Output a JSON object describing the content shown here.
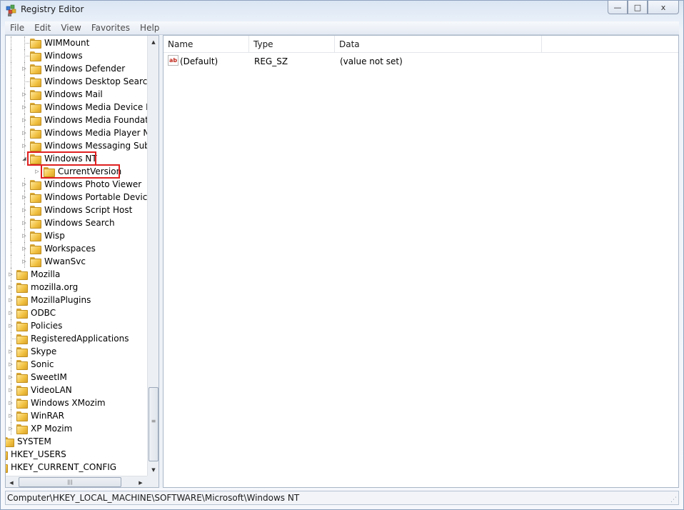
{
  "window": {
    "title": "Registry Editor",
    "caption_min": "—",
    "caption_max": "□",
    "caption_close": "x"
  },
  "menu": [
    "File",
    "Edit",
    "View",
    "Favorites",
    "Help"
  ],
  "tree": [
    {
      "label": "WIMMount",
      "level": 2,
      "expander": "none"
    },
    {
      "label": "Windows",
      "level": 2,
      "expander": "none"
    },
    {
      "label": "Windows Defender",
      "level": 2,
      "expander": "collapsed"
    },
    {
      "label": "Windows Desktop Search",
      "level": 2,
      "expander": "none"
    },
    {
      "label": "Windows Mail",
      "level": 2,
      "expander": "collapsed"
    },
    {
      "label": "Windows Media Device Ma",
      "level": 2,
      "expander": "collapsed"
    },
    {
      "label": "Windows Media Foundation",
      "level": 2,
      "expander": "collapsed"
    },
    {
      "label": "Windows Media Player NSS",
      "level": 2,
      "expander": "collapsed"
    },
    {
      "label": "Windows Messaging Subsy",
      "level": 2,
      "expander": "collapsed"
    },
    {
      "label": "Windows NT",
      "level": 2,
      "expander": "expanded",
      "highlighted": true
    },
    {
      "label": "CurrentVersion",
      "level": 3,
      "expander": "collapsed",
      "highlighted": true
    },
    {
      "label": "Windows Photo Viewer",
      "level": 2,
      "expander": "collapsed"
    },
    {
      "label": "Windows Portable Devices",
      "level": 2,
      "expander": "collapsed"
    },
    {
      "label": "Windows Script Host",
      "level": 2,
      "expander": "collapsed"
    },
    {
      "label": "Windows Search",
      "level": 2,
      "expander": "collapsed"
    },
    {
      "label": "Wisp",
      "level": 2,
      "expander": "collapsed"
    },
    {
      "label": "Workspaces",
      "level": 2,
      "expander": "collapsed"
    },
    {
      "label": "WwanSvc",
      "level": 2,
      "expander": "collapsed"
    },
    {
      "label": "Mozilla",
      "level": 1,
      "expander": "collapsed"
    },
    {
      "label": "mozilla.org",
      "level": 1,
      "expander": "collapsed"
    },
    {
      "label": "MozillaPlugins",
      "level": 1,
      "expander": "collapsed"
    },
    {
      "label": "ODBC",
      "level": 1,
      "expander": "collapsed"
    },
    {
      "label": "Policies",
      "level": 1,
      "expander": "collapsed"
    },
    {
      "label": "RegisteredApplications",
      "level": 1,
      "expander": "none"
    },
    {
      "label": "Skype",
      "level": 1,
      "expander": "collapsed"
    },
    {
      "label": "Sonic",
      "level": 1,
      "expander": "collapsed"
    },
    {
      "label": "SweetIM",
      "level": 1,
      "expander": "collapsed"
    },
    {
      "label": "VideoLAN",
      "level": 1,
      "expander": "collapsed"
    },
    {
      "label": "Windows XMozim",
      "level": 1,
      "expander": "collapsed"
    },
    {
      "label": "WinRAR",
      "level": 1,
      "expander": "collapsed"
    },
    {
      "label": "XP Mozim",
      "level": 1,
      "expander": "collapsed"
    },
    {
      "label": "SYSTEM",
      "level": 0,
      "expander": "none"
    },
    {
      "label": "HKEY_USERS",
      "level": -1,
      "expander": "none"
    },
    {
      "label": "HKEY_CURRENT_CONFIG",
      "level": -1,
      "expander": "none"
    }
  ],
  "list": {
    "columns": [
      "Name",
      "Type",
      "Data"
    ],
    "rows": [
      {
        "name": "(Default)",
        "type": "REG_SZ",
        "data": "(value not set)",
        "icon": "string-value-icon"
      }
    ]
  },
  "status": {
    "path": "Computer\\HKEY_LOCAL_MACHINE\\SOFTWARE\\Microsoft\\Windows NT"
  },
  "colors": {
    "highlight_box": "#e02020",
    "folder": "#f0c040"
  }
}
